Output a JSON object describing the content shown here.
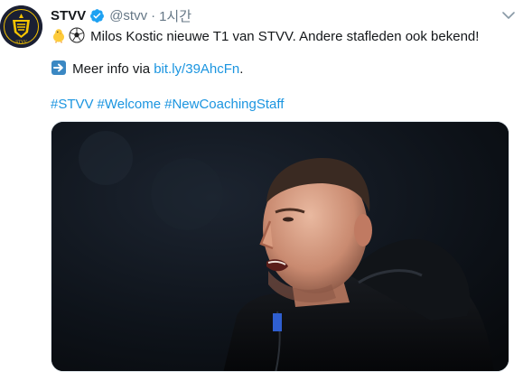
{
  "account": {
    "display_name": "STVV",
    "handle": "@stvv",
    "separator": "·",
    "timestamp": "1시간",
    "avatar_text": "STVV"
  },
  "tweet": {
    "line1_text": "Milos Kostic nieuwe T1 van STVV. Andere stafleden ook bekend!",
    "line2_prefix": "Meer info via ",
    "link_text": "bit.ly/39AhcFn",
    "line2_suffix": ".",
    "hashtags": [
      "#STVV",
      "#Welcome",
      "#NewCoachingStaff"
    ]
  },
  "colors": {
    "link": "#1b95e0",
    "verified": "#1da1f2",
    "secondary_text": "#657786",
    "avatar_bg": "#1a1f33",
    "avatar_accent": "#f5c400"
  },
  "icons": {
    "verified": "verified-badge-icon",
    "caret": "chevron-down-icon",
    "chick": "baby-chick-emoji",
    "ball": "soccer-ball-emoji",
    "arrow": "right-arrow-emoji"
  }
}
